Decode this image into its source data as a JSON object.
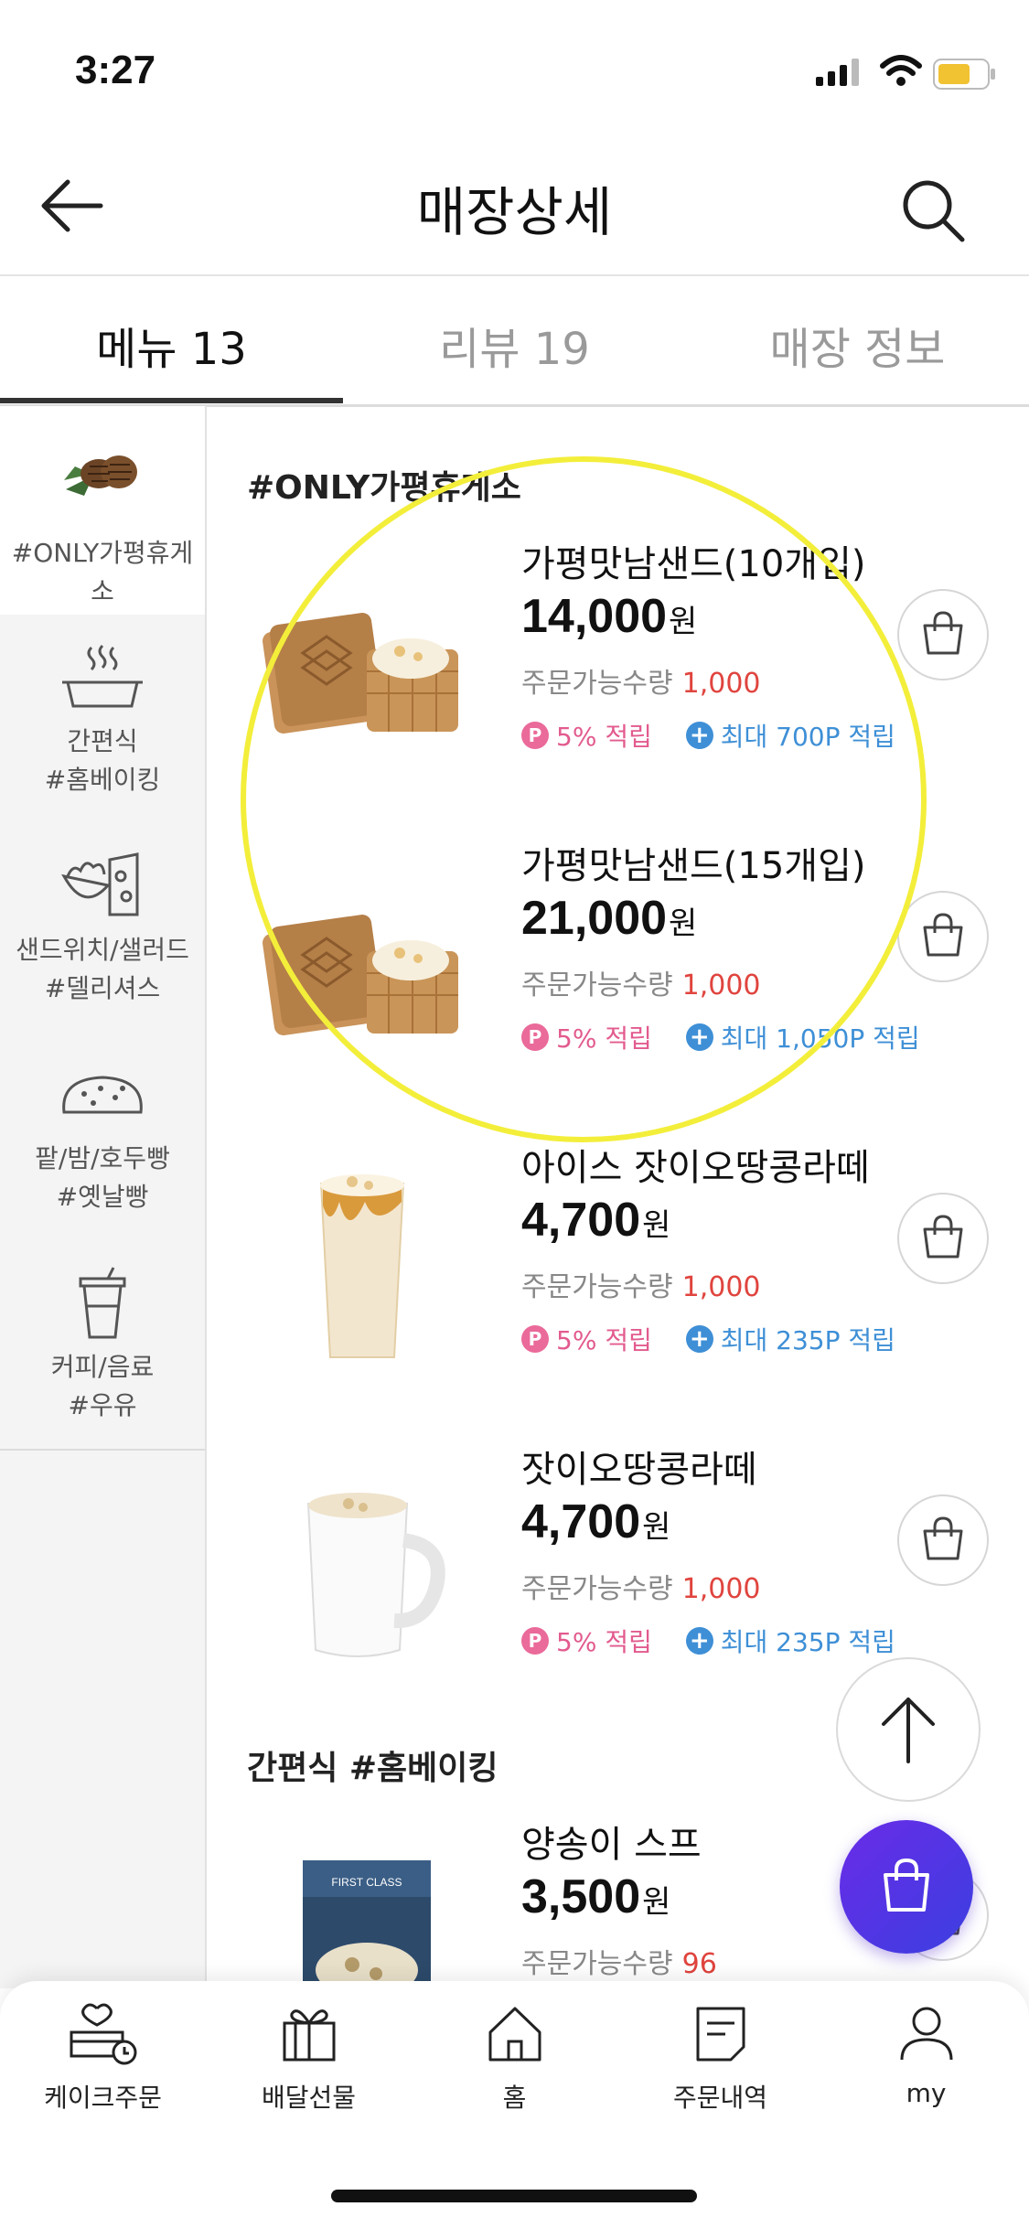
{
  "status_bar": {
    "time": "3:27"
  },
  "header": {
    "title": "매장상세"
  },
  "tabs": [
    {
      "label": "메뉴 13"
    },
    {
      "label": "리뷰 19"
    },
    {
      "label": "매장 정보"
    }
  ],
  "sidebar": {
    "categories": [
      {
        "label": "#ONLY가평휴게소"
      },
      {
        "label_line1": "간편식",
        "label_line2": "#홈베이킹"
      },
      {
        "label_line1": "샌드위치/샐러드",
        "label_line2": "#델리셔스"
      },
      {
        "label_line1": "팥/밤/호두빵",
        "label_line2": "#옛날빵"
      },
      {
        "label_line1": "커피/음료",
        "label_line2": "#우유"
      }
    ]
  },
  "sections": {
    "only": {
      "title": "#ONLY가평휴게소"
    },
    "baking": {
      "title": "간편식 #홈베이킹"
    }
  },
  "common": {
    "qty_label": "주문가능수량",
    "won": "원",
    "point_badge": "P",
    "point_rate": "5% 적립"
  },
  "items": [
    {
      "name": "가평맛남샌드(10개입)",
      "price": "14,000",
      "qty": "1,000",
      "max_point": "최대 700P 적립"
    },
    {
      "name": "가평맛남샌드(15개입)",
      "price": "21,000",
      "qty": "1,000",
      "max_point": "최대 1,050P 적립"
    },
    {
      "name": "아이스 잣이오땅콩라떼",
      "price": "4,700",
      "qty": "1,000",
      "max_point": "최대 235P 적립"
    },
    {
      "name": "잣이오땅콩라떼",
      "price": "4,700",
      "qty": "1,000",
      "max_point": "최대 235P 적립"
    },
    {
      "name": "양송이 스프",
      "price": "3,500",
      "qty": "96"
    }
  ],
  "product_art": {
    "soup_box_text": "FIRST CLASS"
  },
  "bottom_nav": [
    {
      "label": "케이크주문"
    },
    {
      "label": "배달선물"
    },
    {
      "label": "홈"
    },
    {
      "label": "주문내역"
    },
    {
      "label": "my"
    }
  ],
  "colors": {
    "qty_number": "#e0443e",
    "point_pink": "#e25b8e",
    "point_blue": "#3e8fd6",
    "highlight": "#f3ee3a",
    "fab_gradient": [
      "#6a2be8",
      "#3b3fe0"
    ]
  }
}
